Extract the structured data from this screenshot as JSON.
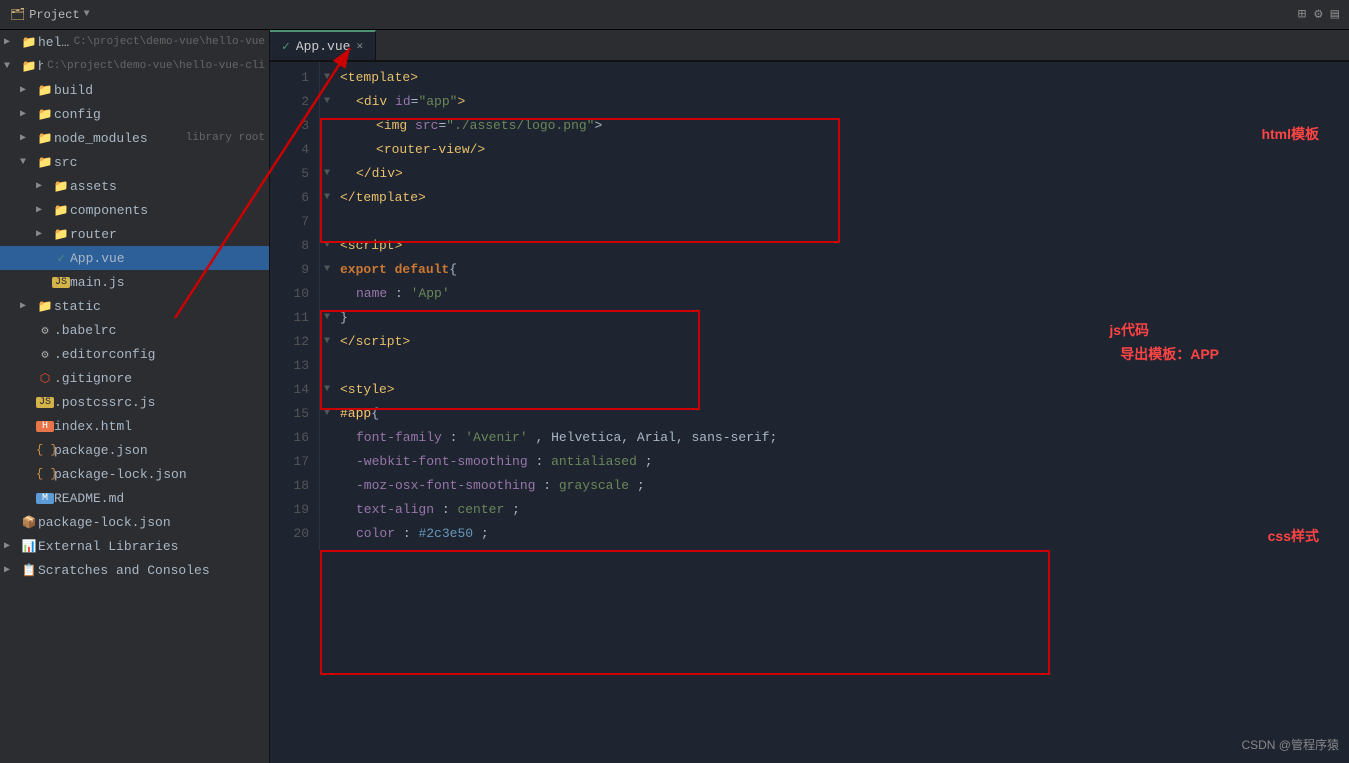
{
  "topbar": {
    "project_label": "Project",
    "icons": [
      "⊞",
      "⚙",
      "▤"
    ]
  },
  "sidebar": {
    "items": [
      {
        "id": "hello-vue",
        "level": 1,
        "type": "folder",
        "label": "hello-vue",
        "sublabel": "C:\\project\\demo-vue\\hello-vue",
        "arrow": "▶",
        "expanded": false
      },
      {
        "id": "hello-vue-cli",
        "level": 1,
        "type": "folder",
        "label": "hello-vue-cli",
        "sublabel": "C:\\project\\demo-vue\\hello-vue-cli",
        "arrow": "▼",
        "expanded": true
      },
      {
        "id": "build",
        "level": 2,
        "type": "folder",
        "label": "build",
        "arrow": "▶",
        "expanded": false
      },
      {
        "id": "config",
        "level": 2,
        "type": "folder",
        "label": "config",
        "arrow": "▶",
        "expanded": false
      },
      {
        "id": "node_modules",
        "level": 2,
        "type": "folder",
        "label": "node_modules",
        "sublabel": "library root",
        "arrow": "▶",
        "expanded": false
      },
      {
        "id": "src",
        "level": 2,
        "type": "folder",
        "label": "src",
        "arrow": "▼",
        "expanded": true
      },
      {
        "id": "assets",
        "level": 3,
        "type": "folder",
        "label": "assets",
        "arrow": "▶",
        "expanded": false
      },
      {
        "id": "components",
        "level": 3,
        "type": "folder",
        "label": "components",
        "arrow": "▶",
        "expanded": false
      },
      {
        "id": "router",
        "level": 3,
        "type": "folder",
        "label": "router",
        "arrow": "▶",
        "expanded": false
      },
      {
        "id": "App.vue",
        "level": 3,
        "type": "vue",
        "label": "App.vue",
        "selected": true
      },
      {
        "id": "main.js",
        "level": 3,
        "type": "js",
        "label": "main.js"
      },
      {
        "id": "static",
        "level": 2,
        "type": "folder",
        "label": "static",
        "arrow": "▶",
        "expanded": false
      },
      {
        "id": ".babelrc",
        "level": 2,
        "type": "config",
        "label": ".babelrc"
      },
      {
        "id": ".editorconfig",
        "level": 2,
        "type": "config",
        "label": ".editorconfig"
      },
      {
        "id": ".gitignore",
        "level": 2,
        "type": "config",
        "label": ".gitignore"
      },
      {
        "id": ".postcssrc.js",
        "level": 2,
        "type": "js",
        "label": ".postcssrc.js"
      },
      {
        "id": "index.html",
        "level": 2,
        "type": "html",
        "label": "index.html"
      },
      {
        "id": "package.json",
        "level": 2,
        "type": "json",
        "label": "package.json"
      },
      {
        "id": "package-lock.json",
        "level": 2,
        "type": "json",
        "label": "package-lock.json"
      },
      {
        "id": "README.md",
        "level": 2,
        "type": "md",
        "label": "README.md"
      },
      {
        "id": "package-lock2.json",
        "level": 1,
        "type": "json",
        "label": "package-lock.json"
      },
      {
        "id": "external-libraries",
        "level": 1,
        "type": "lib",
        "label": "External Libraries"
      },
      {
        "id": "scratches",
        "level": 1,
        "type": "scratch",
        "label": "Scratches and Consoles",
        "arrow": "▶"
      }
    ]
  },
  "tab": {
    "label": "App.vue",
    "close": "✕"
  },
  "code": {
    "lines": [
      {
        "num": 1,
        "fold": true,
        "content": "&lt;template&gt;",
        "type": "tag"
      },
      {
        "num": 2,
        "fold": true,
        "content": "    &lt;div id=\"app\"&gt;",
        "type": "tag"
      },
      {
        "num": 3,
        "content": "        &lt;img src=\"./assets/logo.png\"",
        "type": "tag-attr"
      },
      {
        "num": 4,
        "content": "        &lt;router-view/&gt;",
        "type": "tag"
      },
      {
        "num": 5,
        "fold": true,
        "content": "    &lt;/div&gt;",
        "type": "tag"
      },
      {
        "num": 6,
        "fold": true,
        "content": "&lt;/template&gt;",
        "type": "tag"
      },
      {
        "num": 7,
        "content": "",
        "type": "empty"
      },
      {
        "num": 8,
        "fold": true,
        "content": "&lt;script&gt;",
        "type": "tag"
      },
      {
        "num": 9,
        "fold": true,
        "content": "export default {",
        "type": "keyword"
      },
      {
        "num": 10,
        "content": "    name: 'App'",
        "type": "property"
      },
      {
        "num": 11,
        "fold": true,
        "content": "}",
        "type": "normal"
      },
      {
        "num": 12,
        "fold": true,
        "content": "&lt;/script&gt;",
        "type": "tag"
      },
      {
        "num": 13,
        "content": "",
        "type": "empty"
      },
      {
        "num": 14,
        "fold": true,
        "content": "&lt;style&gt;",
        "type": "tag"
      },
      {
        "num": 15,
        "fold": true,
        "content": "#app {",
        "type": "selector"
      },
      {
        "num": 16,
        "content": "    font-family: 'Avenir', Helvetica, Arial, sans-serif;",
        "type": "css-prop"
      },
      {
        "num": 17,
        "content": "    -webkit-font-smoothing: antialiased;",
        "type": "css-prop"
      },
      {
        "num": 18,
        "content": "    -moz-osx-font-smoothing: grayscale;",
        "type": "css-prop"
      },
      {
        "num": 19,
        "content": "    text-align: center;",
        "type": "css-prop"
      },
      {
        "num": 20,
        "content": "    color: #2c3e50;",
        "type": "css-prop"
      }
    ]
  },
  "annotations": {
    "html_label": "html模板",
    "js_label1": "js代码",
    "js_label2": "导出模板：APP",
    "css_label": "css样式"
  },
  "watermark": "CSDN @管程序猿"
}
